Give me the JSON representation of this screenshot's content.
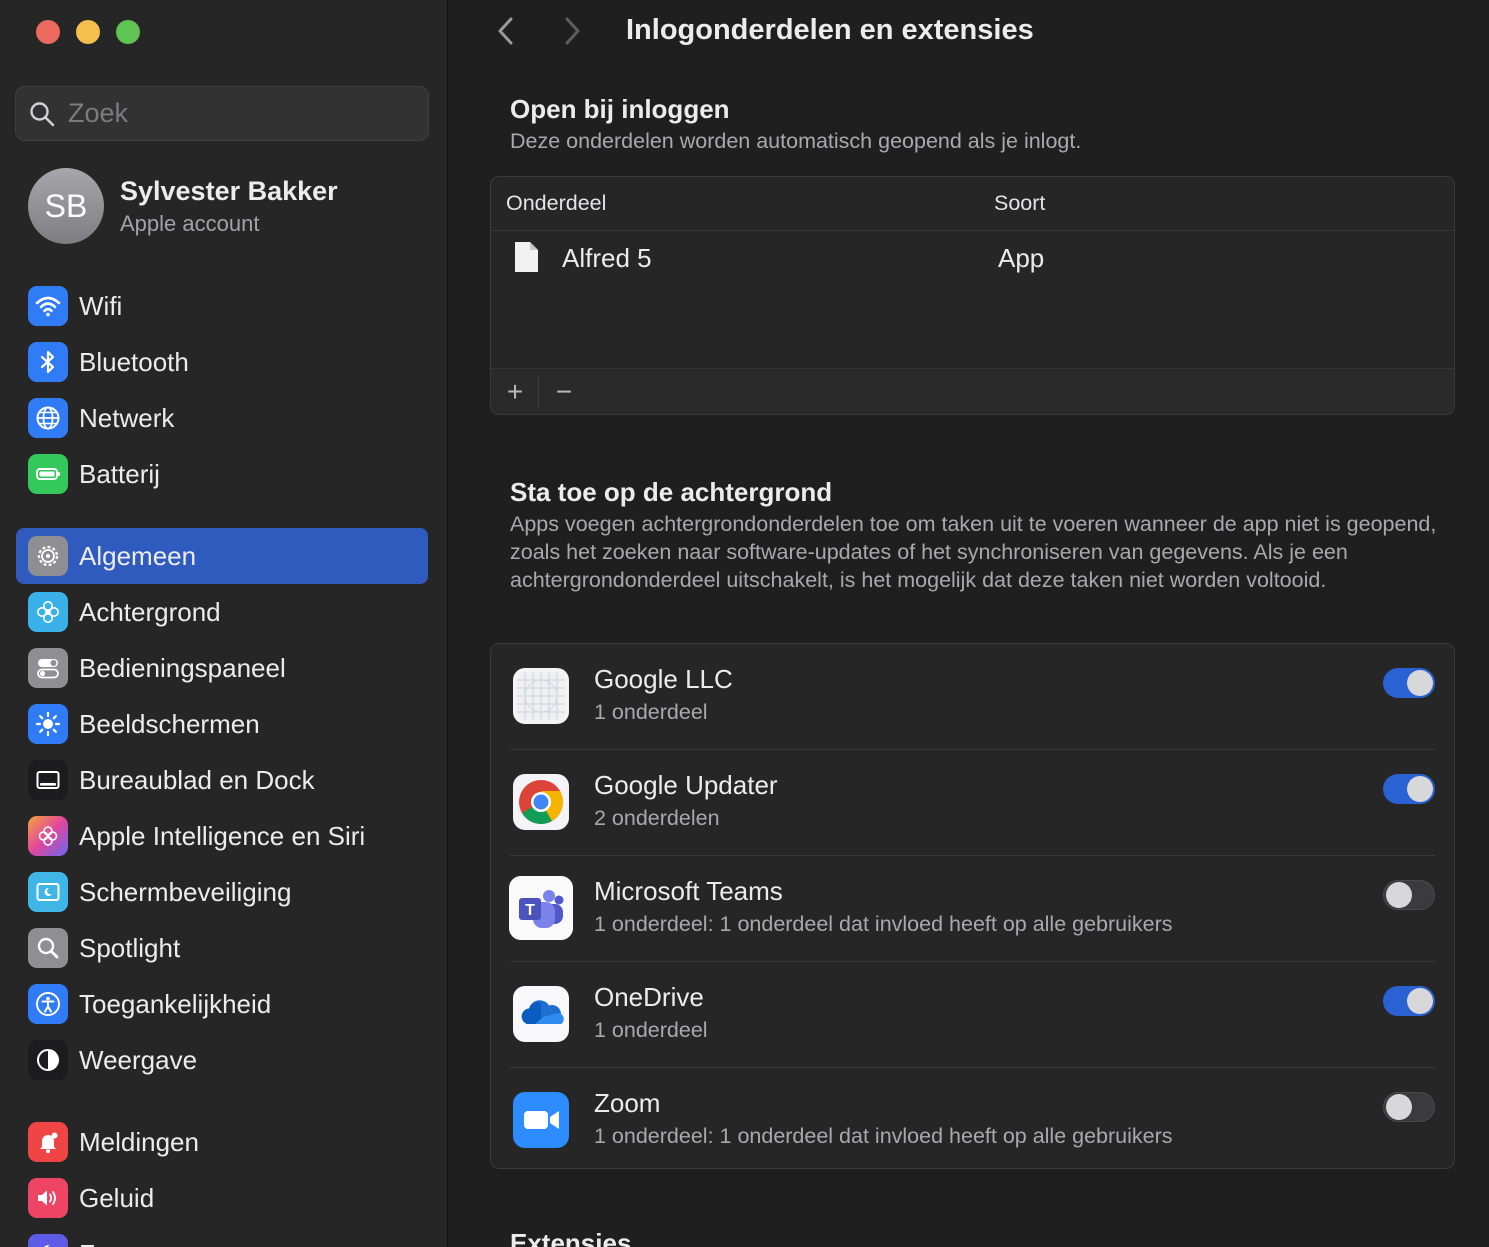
{
  "window": {
    "title": "Inlogonderdelen en extensies"
  },
  "sidebar": {
    "search_placeholder": "Zoek",
    "account": {
      "initials": "SB",
      "name": "Sylvester Bakker",
      "subtitle": "Apple account"
    },
    "groups": [
      [
        {
          "label": "Wifi",
          "icon": "wifi-icon",
          "color": "#2f7cf6"
        },
        {
          "label": "Bluetooth",
          "icon": "bluetooth-icon",
          "color": "#2f7cf6"
        },
        {
          "label": "Netwerk",
          "icon": "globe-icon",
          "color": "#2f7cf6"
        },
        {
          "label": "Batterij",
          "icon": "battery-icon",
          "color": "#34c759"
        }
      ],
      [
        {
          "label": "Algemeen",
          "icon": "gear-icon",
          "color": "#8e8e93",
          "active": true
        },
        {
          "label": "Achtergrond",
          "icon": "flower-icon",
          "color": "#3ab0e8"
        },
        {
          "label": "Bedieningspaneel",
          "icon": "switches-icon",
          "color": "#8e8e93"
        },
        {
          "label": "Beeldschermen",
          "icon": "sun-icon",
          "color": "#2f7cf6"
        },
        {
          "label": "Bureaublad en Dock",
          "icon": "dock-icon",
          "color": "#1c1c1e"
        },
        {
          "label": "Apple Intelligence en Siri",
          "icon": "siri-icon",
          "color": "#d05ac0"
        },
        {
          "label": "Schermbeveiliging",
          "icon": "screensaver-icon",
          "color": "#40b6e6"
        },
        {
          "label": "Spotlight",
          "icon": "magnifier-icon",
          "color": "#8e8e93"
        },
        {
          "label": "Toegankelijkheid",
          "icon": "accessibility-icon",
          "color": "#2f7cf6"
        },
        {
          "label": "Weergave",
          "icon": "appearance-icon",
          "color": "#1c1c1e"
        }
      ],
      [
        {
          "label": "Meldingen",
          "icon": "bell-icon",
          "color": "#ef4545"
        },
        {
          "label": "Geluid",
          "icon": "speaker-icon",
          "color": "#ef4565"
        },
        {
          "label": "Focus",
          "icon": "moon-icon",
          "color": "#5e5ce6"
        }
      ]
    ]
  },
  "open_at_login": {
    "title": "Open bij inloggen",
    "description": "Deze onderdelen worden automatisch geopend als je inlogt.",
    "columns": [
      "Onderdeel",
      "Soort"
    ],
    "rows": [
      {
        "name": "Alfred 5",
        "type": "App"
      }
    ],
    "add_label": "+",
    "remove_label": "−"
  },
  "background": {
    "title": "Sta toe op de achtergrond",
    "description": "Apps voegen achtergrondonderdelen toe om taken uit te voeren wanneer de app niet is geopend, zoals het zoeken naar software-updates of het synchroniseren van gegevens. Als je een achtergrondonderdeel uitschakelt, is het mogelijk dat deze taken niet worden voltooid.",
    "items": [
      {
        "name": "Google LLC",
        "subtitle": "1 onderdeel",
        "enabled": true,
        "icon": "google-llc-icon"
      },
      {
        "name": "Google Updater",
        "subtitle": "2 onderdelen",
        "enabled": true,
        "icon": "chrome-icon"
      },
      {
        "name": "Microsoft Teams",
        "subtitle": "1 onderdeel: 1 onderdeel dat invloed heeft op alle gebruikers",
        "enabled": false,
        "icon": "teams-icon"
      },
      {
        "name": "OneDrive",
        "subtitle": "1 onderdeel",
        "enabled": true,
        "icon": "onedrive-icon"
      },
      {
        "name": "Zoom",
        "subtitle": "1 onderdeel: 1 onderdeel dat invloed heeft op alle gebruikers",
        "enabled": false,
        "icon": "zoom-icon"
      }
    ]
  },
  "extensions": {
    "title": "Extensies"
  }
}
